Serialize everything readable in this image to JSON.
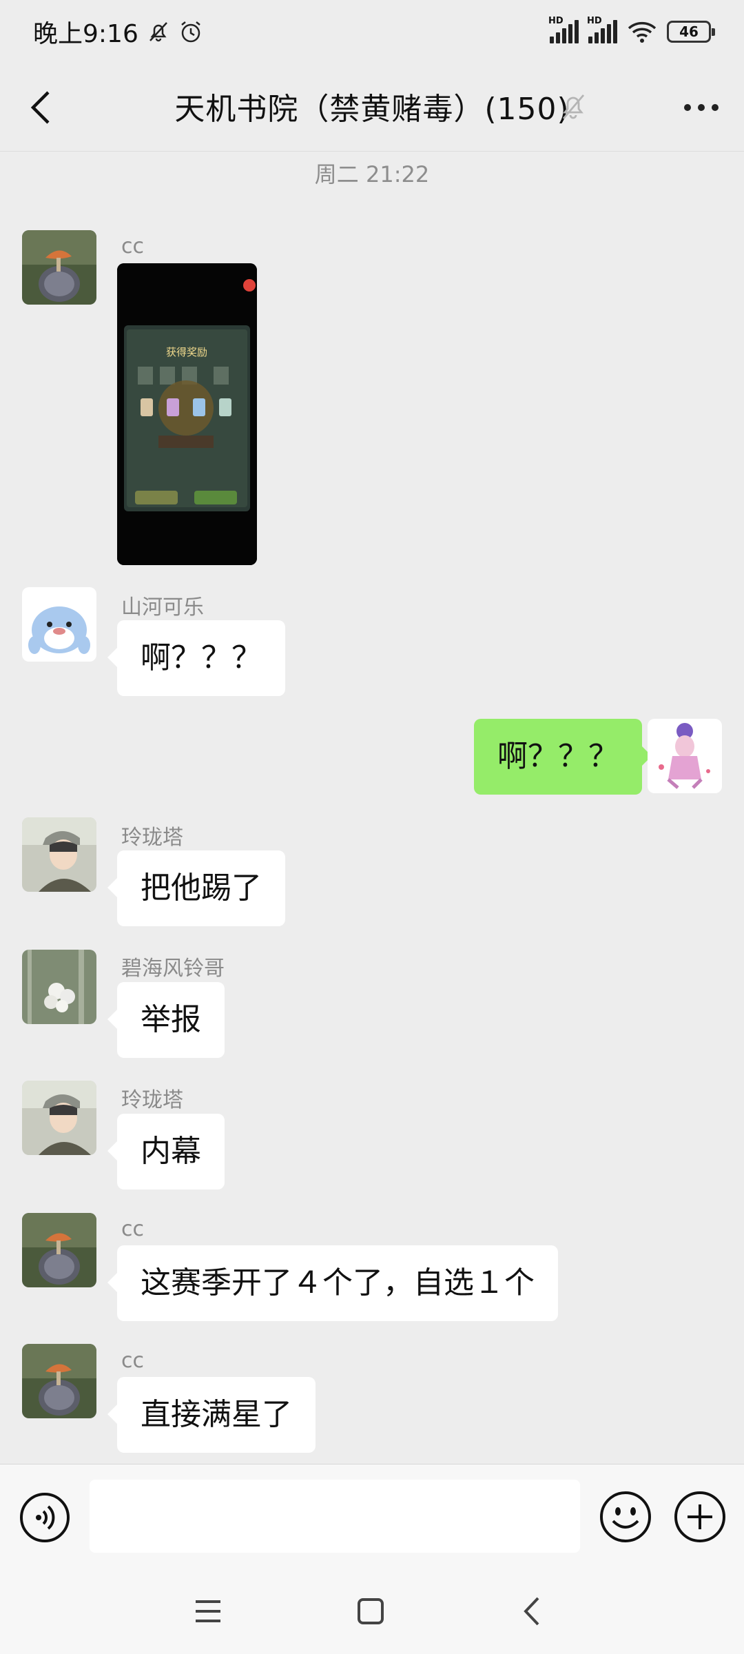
{
  "status_bar": {
    "time": "晚上9:16",
    "battery": "46",
    "hd1": "HD",
    "hd2": "HD"
  },
  "chat": {
    "title": "天机书院（禁黄赌毒）(150)",
    "timestamp": "周二 21:22"
  },
  "messages": [
    {
      "sender": "cc",
      "type": "image",
      "image_text": {
        "title": "获得奖励"
      }
    },
    {
      "sender": "山河可乐",
      "text": "啊？？？"
    },
    {
      "sender": "me",
      "text": "啊？？？"
    },
    {
      "sender": "玲珑塔",
      "text": "把他踢了"
    },
    {
      "sender": "碧海风铃哥",
      "text": "举报"
    },
    {
      "sender": "玲珑塔",
      "text": "内幕"
    },
    {
      "sender": "cc",
      "text": "这赛季开了４个了，自选１个"
    },
    {
      "sender": "cc",
      "text": "直接满星了"
    }
  ],
  "input": {
    "value": "",
    "placeholder": ""
  },
  "colors": {
    "self_bubble": "#95ec69",
    "other_bubble": "#ffffff",
    "background": "#ededed"
  },
  "icons": [
    "back-arrow-icon",
    "mute-bell-icon",
    "more-icon",
    "voice-icon",
    "emoji-icon",
    "plus-icon",
    "menu-icon",
    "home-icon",
    "back-icon"
  ]
}
